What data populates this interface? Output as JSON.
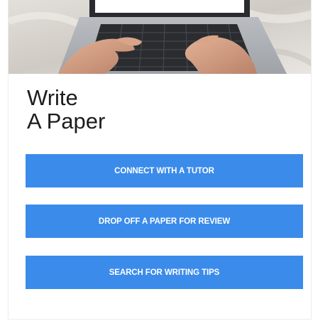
{
  "card": {
    "title_line1": "Write",
    "title_line2": "A Paper",
    "hero_image": "hands-typing-on-laptop"
  },
  "buttons": [
    {
      "label": "CONNECT WITH A TUTOR"
    },
    {
      "label": "DROP OFF A PAPER FOR REVIEW"
    },
    {
      "label": "SEARCH FOR WRITING TIPS"
    }
  ],
  "colors": {
    "button_bg": "#3b8beb",
    "button_text": "#ffffff",
    "title_text": "#1c1c1c"
  }
}
